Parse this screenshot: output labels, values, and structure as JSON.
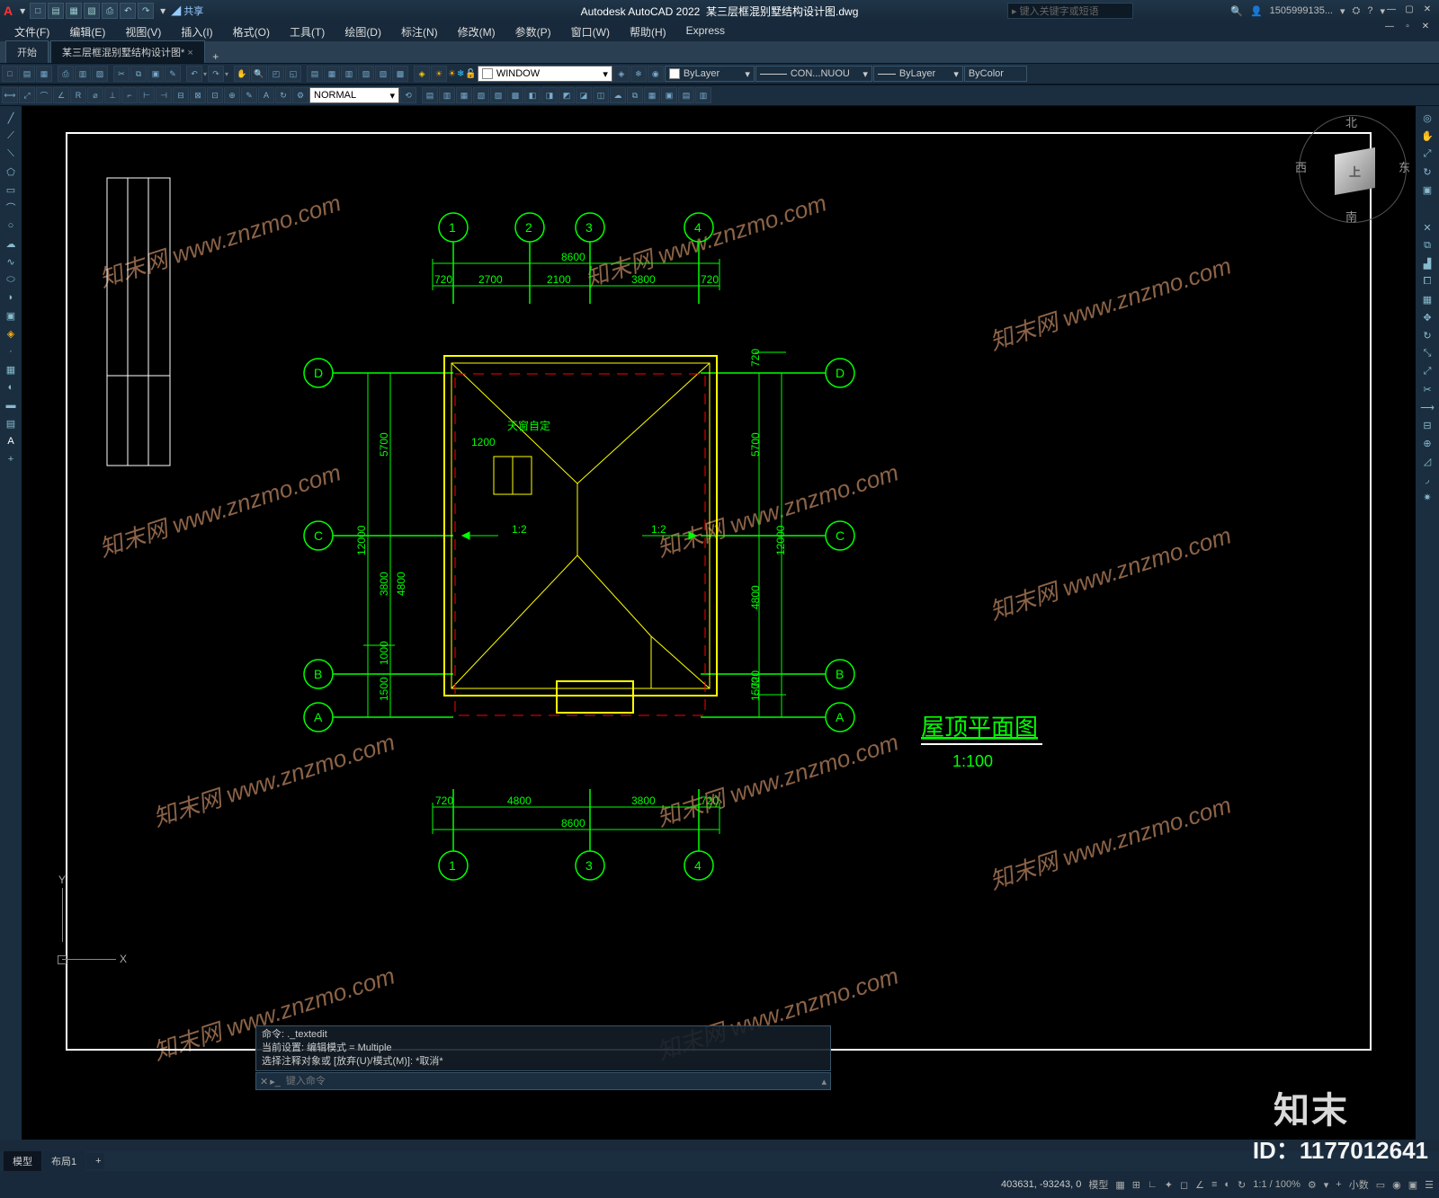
{
  "app": {
    "name": "Autodesk AutoCAD 2022",
    "file": "某三层框混别墅结构设计图.dwg",
    "logo": "A"
  },
  "titlebar": {
    "share": "共享",
    "search_placeholder": "键入关键字或短语",
    "user": "1505999135...",
    "help": "?"
  },
  "menu": [
    "文件(F)",
    "编辑(E)",
    "视图(V)",
    "插入(I)",
    "格式(O)",
    "工具(T)",
    "绘图(D)",
    "标注(N)",
    "修改(M)",
    "参数(P)",
    "窗口(W)",
    "帮助(H)",
    "Express"
  ],
  "tabs": {
    "start": "开始",
    "file": "某三层框混别墅结构设计图*"
  },
  "toolbar": {
    "layer_filter": "WINDOW",
    "layer_current": "ByLayer",
    "linetype": "CON...NUOU",
    "lineweight": "ByLayer",
    "plotstyle": "ByColor",
    "textstyle": "NORMAL"
  },
  "viewcube": {
    "n": "北",
    "s": "南",
    "e": "东",
    "w": "西",
    "top": "上"
  },
  "ucs": {
    "x": "X",
    "y": "Y"
  },
  "drawing": {
    "title": "屋顶平面图",
    "scale": "1:100",
    "top_total": "8600",
    "top_dims": [
      "720",
      "2700",
      "2100",
      "3800",
      "720"
    ],
    "top_grids": [
      "1",
      "2",
      "3",
      "4"
    ],
    "bottom_total": "8600",
    "bottom_dims": [
      "720",
      "4800",
      "3800",
      "720"
    ],
    "bottom_grids": [
      "1",
      "3",
      "4"
    ],
    "left_total": "12000",
    "left_dims": [
      "1500",
      "1000",
      "3800",
      "5700"
    ],
    "left_d2": "4800",
    "right_total": "12000",
    "right_dims": [
      "1500",
      "4800",
      "5700"
    ],
    "right_720top": "720",
    "right_720bot": "720",
    "row_grids": [
      "A",
      "B",
      "C",
      "D"
    ],
    "skylight_label": "天窗自定",
    "skylight_dim": "1200",
    "slope1": "1:2",
    "slope2": "1:2"
  },
  "command": {
    "hist1": "命令: ._textedit",
    "hist2": "当前设置: 编辑模式 = Multiple",
    "hist3": "选择注释对象或 [放弃(U)/模式(M)]: *取消*",
    "prompt": "键入命令"
  },
  "model_tabs": {
    "model": "模型",
    "layout1": "布局1"
  },
  "status": {
    "coords": "403631, -93243, 0",
    "space": "模型",
    "grid": "#",
    "scale": "1:1 / 100%",
    "decimal": "小数",
    "angle": "十"
  },
  "watermark": {
    "cn": "知末网",
    "en": "www.znzmo.com",
    "brand": "知末",
    "id": "ID：1177012641"
  }
}
